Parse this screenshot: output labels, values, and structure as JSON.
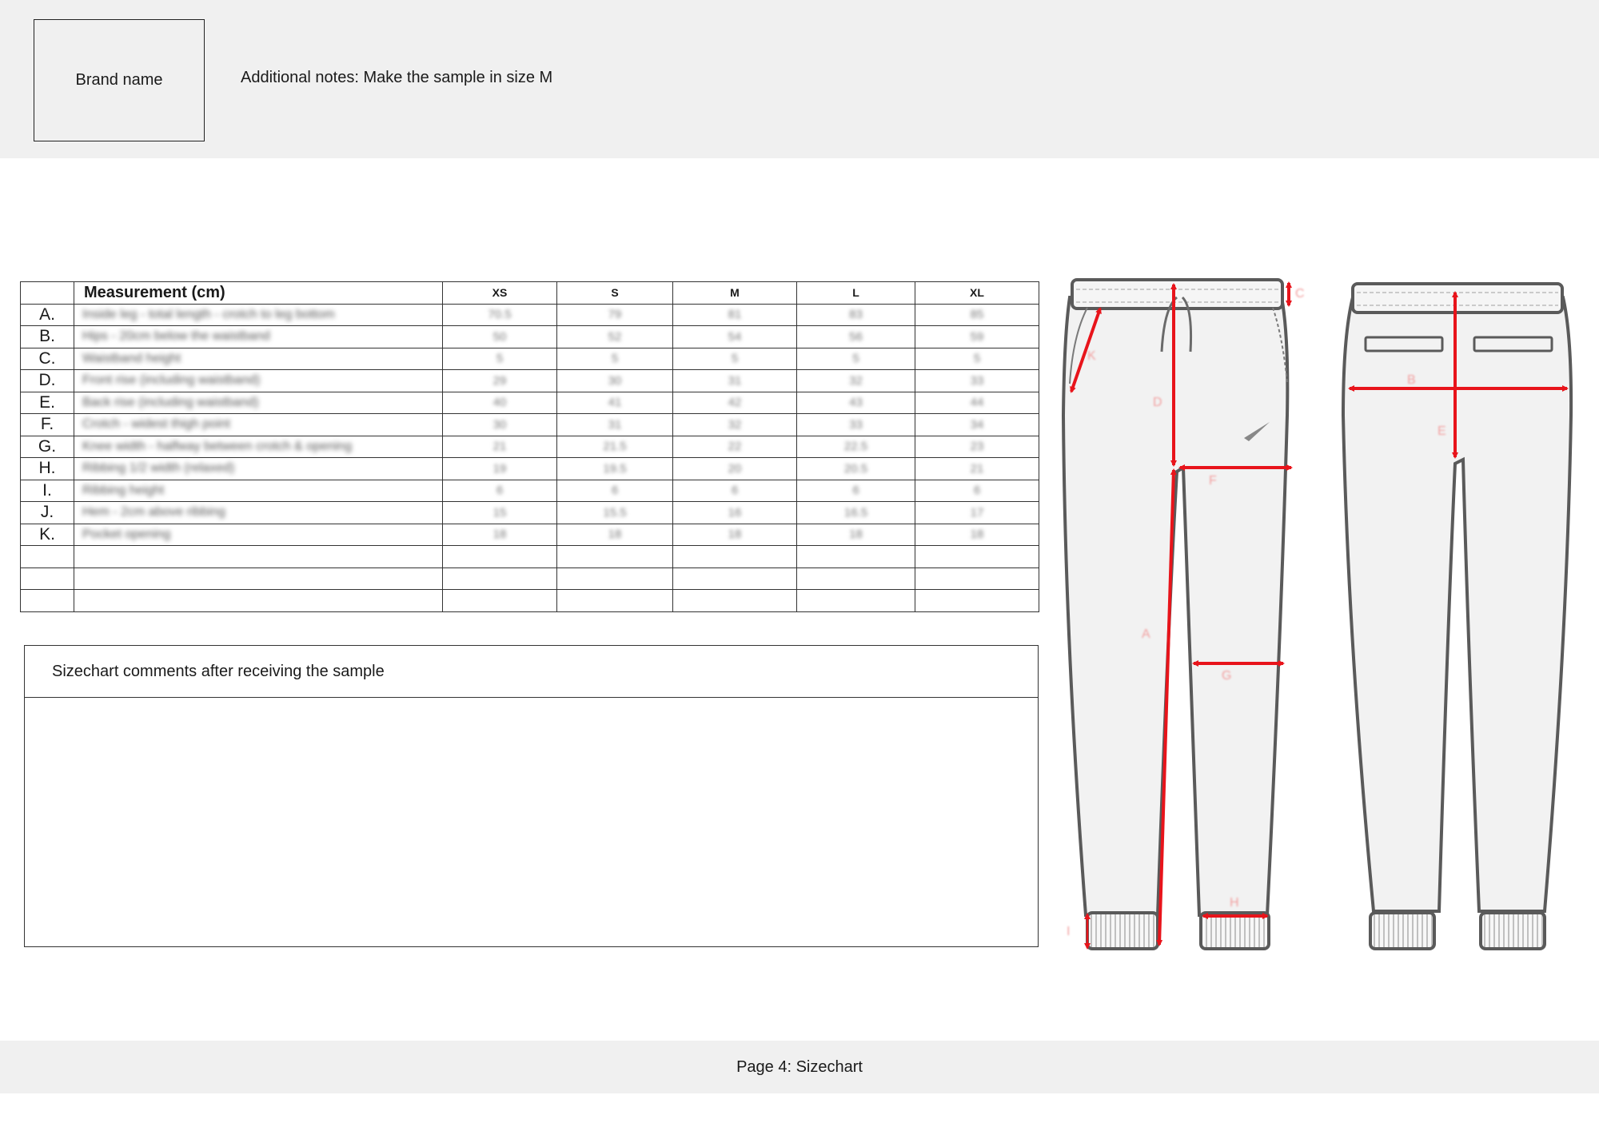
{
  "header": {
    "brand_name": "Brand name",
    "additional_notes": "Additional notes: Make the sample in size M"
  },
  "sizechart": {
    "measurement_header": "Measurement (cm)",
    "sizes": [
      "XS",
      "S",
      "M",
      "L",
      "XL"
    ],
    "rows": [
      {
        "letter": "A.",
        "desc": "Inside leg - total length - crotch to leg bottom",
        "values": [
          "70.5",
          "79",
          "81",
          "83",
          "85"
        ]
      },
      {
        "letter": "B.",
        "desc": "Hips - 20cm below the waistband",
        "values": [
          "50",
          "52",
          "54",
          "56",
          "59"
        ]
      },
      {
        "letter": "C.",
        "desc": "Waistband height",
        "values": [
          "5",
          "5",
          "5",
          "5",
          "5"
        ]
      },
      {
        "letter": "D.",
        "desc": "Front rise (including waistband)",
        "values": [
          "29",
          "30",
          "31",
          "32",
          "33"
        ]
      },
      {
        "letter": "E.",
        "desc": "Back rise (including waistband)",
        "values": [
          "40",
          "41",
          "42",
          "43",
          "44"
        ]
      },
      {
        "letter": "F.",
        "desc": "Crotch - widest thigh point",
        "values": [
          "30",
          "31",
          "32",
          "33",
          "34"
        ]
      },
      {
        "letter": "G.",
        "desc": "Knee width - halfway between crotch & opening",
        "values": [
          "21",
          "21.5",
          "22",
          "22.5",
          "23"
        ]
      },
      {
        "letter": "H.",
        "desc": "Ribbing 1/2 width (relaxed)",
        "values": [
          "19",
          "19.5",
          "20",
          "20.5",
          "21"
        ]
      },
      {
        "letter": "I.",
        "desc": "Ribbing height",
        "values": [
          "6",
          "6",
          "6",
          "6",
          "6"
        ]
      },
      {
        "letter": "J.",
        "desc": "Hem - 2cm above ribbing",
        "values": [
          "15",
          "15.5",
          "16",
          "16.5",
          "17"
        ]
      },
      {
        "letter": "K.",
        "desc": "Pocket opening",
        "values": [
          "18",
          "18",
          "18",
          "18",
          "18"
        ]
      }
    ]
  },
  "comments": {
    "title": "Sizechart comments after receiving the sample",
    "body": ""
  },
  "drawing_labels": {
    "a": "A",
    "b": "B",
    "c": "C",
    "d": "D",
    "e": "E",
    "f": "F",
    "g": "G",
    "h": "H",
    "i": "I",
    "k": "K"
  },
  "footer": {
    "page_label": "Page 4: Sizechart"
  },
  "colors": {
    "band": "#f0f0f0",
    "measure_red": "#e8141b",
    "garment_fill": "#f2f2f2",
    "garment_stroke": "#5a5a5a"
  }
}
